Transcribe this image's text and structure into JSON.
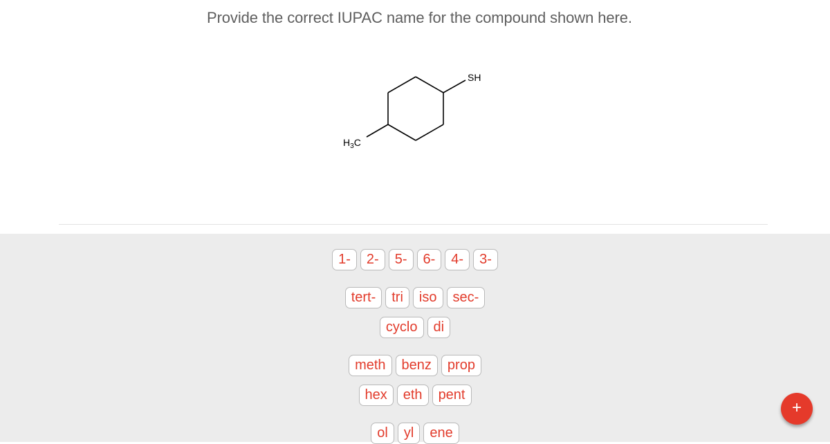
{
  "question": {
    "text": "Provide the correct IUPAC name for the compound shown here."
  },
  "molecule": {
    "description": "4-methylcyclohexane ring with thiol",
    "labels": {
      "thiol": "SH",
      "methyl_main": "H",
      "methyl_sub": "3",
      "methyl_end": "C"
    }
  },
  "tiles": {
    "locants": [
      "1-",
      "2-",
      "5-",
      "6-",
      "4-",
      "3-"
    ],
    "prefixes_row1": [
      "tert-",
      "tri",
      "iso",
      "sec-"
    ],
    "prefixes_row2": [
      "cyclo",
      "di"
    ],
    "roots_row1": [
      "meth",
      "benz",
      "prop"
    ],
    "roots_row2": [
      "hex",
      "eth",
      "pent"
    ],
    "suffixes": [
      "ol",
      "yl",
      "ene"
    ]
  },
  "fab": {
    "label": "+",
    "icon": "plus-icon"
  },
  "colors": {
    "accent": "#e53a2b",
    "chip_text": "#e23b2b",
    "panel_bg": "#ececec",
    "question_text": "#5e5e5e"
  }
}
